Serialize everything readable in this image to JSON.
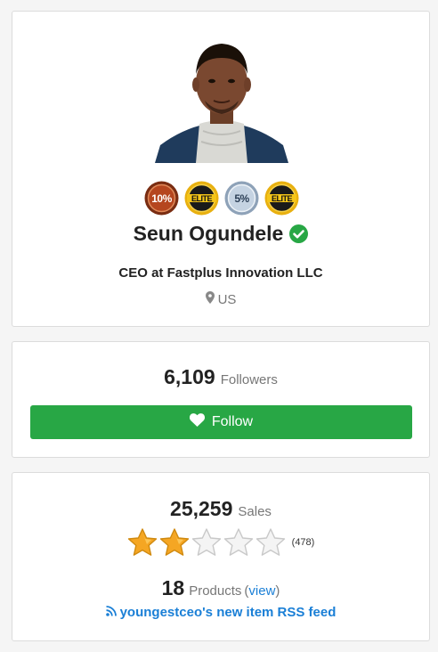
{
  "profile": {
    "name": "Seun Ogundele",
    "title": "CEO at Fastplus Innovation LLC",
    "location": "US",
    "badges": [
      {
        "icon": "top-10-percent-badge-icon",
        "label": "10%"
      },
      {
        "icon": "elite-badge-icon",
        "label": "ELITE"
      },
      {
        "icon": "top-5-percent-badge-icon",
        "label": "5%"
      },
      {
        "icon": "elite-badge-icon",
        "label": "ELITE"
      }
    ]
  },
  "follow": {
    "count": "6,109",
    "label": "Followers",
    "button_label": "Follow"
  },
  "stats": {
    "sales_count": "25,259",
    "sales_label": "Sales",
    "rating_stars": 2,
    "rating_max": 5,
    "rating_count": "(478)",
    "products_count": "18",
    "products_label": "Products",
    "view_open": "(",
    "view_label": "view",
    "view_close": ")",
    "rss_label": "youngestceo's new item RSS feed"
  },
  "colors": {
    "accent_green": "#28a745",
    "link_blue": "#1a7fd6",
    "muted_text": "#777777",
    "star_gold": "#f5a623"
  }
}
